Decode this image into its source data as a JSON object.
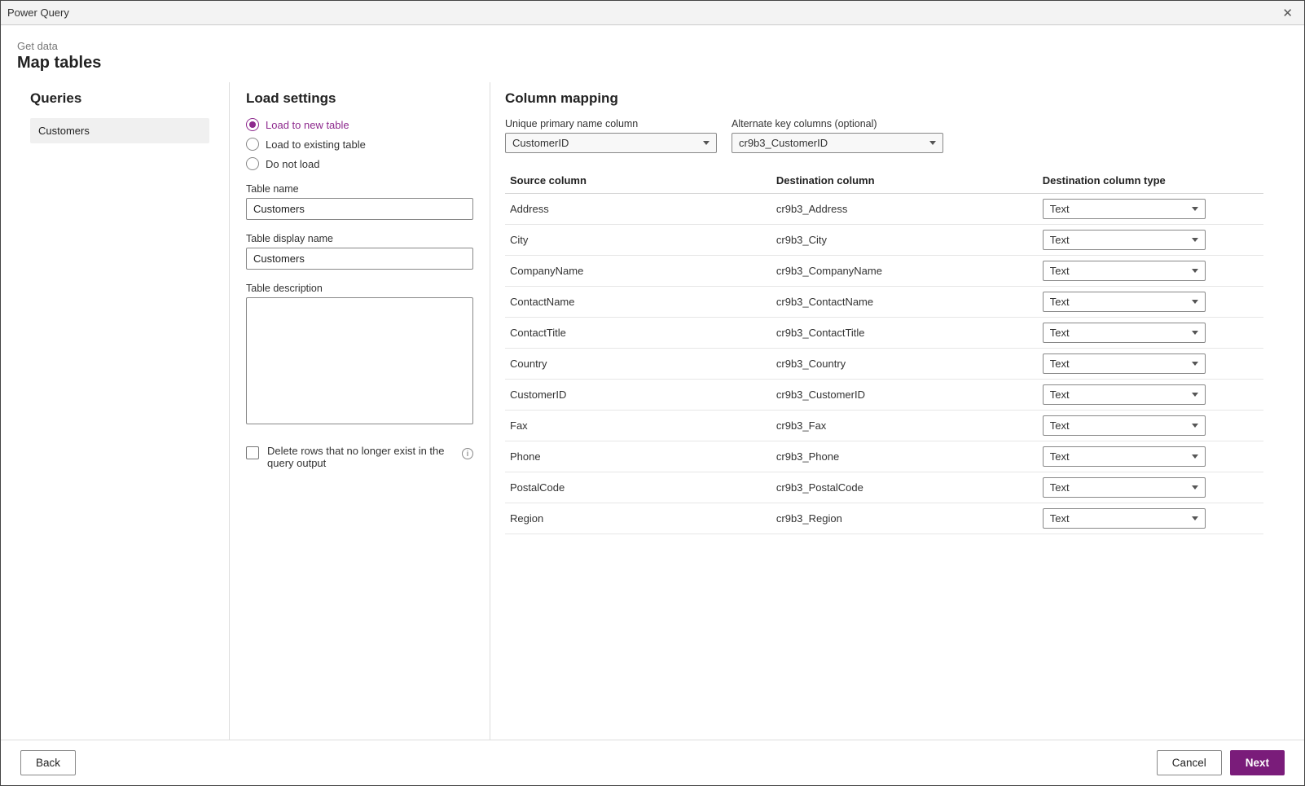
{
  "window": {
    "title": "Power Query"
  },
  "header": {
    "breadcrumb": "Get data",
    "title": "Map tables"
  },
  "queries": {
    "section_title": "Queries",
    "items": [
      "Customers"
    ]
  },
  "load_settings": {
    "section_title": "Load settings",
    "options": {
      "load_new": "Load to new table",
      "load_existing": "Load to existing table",
      "do_not_load": "Do not load"
    },
    "selected_option": "load_new",
    "table_name_label": "Table name",
    "table_name_value": "Customers",
    "table_display_label": "Table display name",
    "table_display_value": "Customers",
    "table_desc_label": "Table description",
    "table_desc_value": "",
    "delete_rows_label": "Delete rows that no longer exist in the query output"
  },
  "column_mapping": {
    "section_title": "Column mapping",
    "primary_label": "Unique primary name column",
    "primary_value": "CustomerID",
    "alt_label": "Alternate key columns (optional)",
    "alt_value": "cr9b3_CustomerID",
    "headers": {
      "source": "Source column",
      "dest": "Destination column",
      "type": "Destination column type"
    },
    "rows": [
      {
        "source": "Address",
        "dest": "cr9b3_Address",
        "type": "Text"
      },
      {
        "source": "City",
        "dest": "cr9b3_City",
        "type": "Text"
      },
      {
        "source": "CompanyName",
        "dest": "cr9b3_CompanyName",
        "type": "Text"
      },
      {
        "source": "ContactName",
        "dest": "cr9b3_ContactName",
        "type": "Text"
      },
      {
        "source": "ContactTitle",
        "dest": "cr9b3_ContactTitle",
        "type": "Text"
      },
      {
        "source": "Country",
        "dest": "cr9b3_Country",
        "type": "Text"
      },
      {
        "source": "CustomerID",
        "dest": "cr9b3_CustomerID",
        "type": "Text"
      },
      {
        "source": "Fax",
        "dest": "cr9b3_Fax",
        "type": "Text"
      },
      {
        "source": "Phone",
        "dest": "cr9b3_Phone",
        "type": "Text"
      },
      {
        "source": "PostalCode",
        "dest": "cr9b3_PostalCode",
        "type": "Text"
      },
      {
        "source": "Region",
        "dest": "cr9b3_Region",
        "type": "Text"
      }
    ]
  },
  "footer": {
    "back": "Back",
    "cancel": "Cancel",
    "next": "Next"
  }
}
